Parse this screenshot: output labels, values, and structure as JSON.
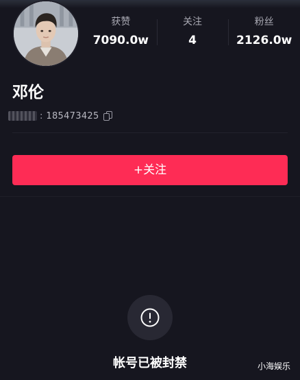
{
  "profile": {
    "name": "邓伦",
    "id_value": "185473425"
  },
  "stats": [
    {
      "label": "获赞",
      "value": "7090.0w"
    },
    {
      "label": "关注",
      "value": "4"
    },
    {
      "label": "粉丝",
      "value": "2126.0w"
    }
  ],
  "actions": {
    "follow_label": "+关注"
  },
  "status": {
    "banned_text": "帐号已被封禁",
    "icon": "exclamation-circle-icon"
  },
  "watermark": "小海娱乐",
  "colors": {
    "background": "#16161f",
    "accent": "#fe2c55",
    "muted_text": "#a9a9b3"
  }
}
